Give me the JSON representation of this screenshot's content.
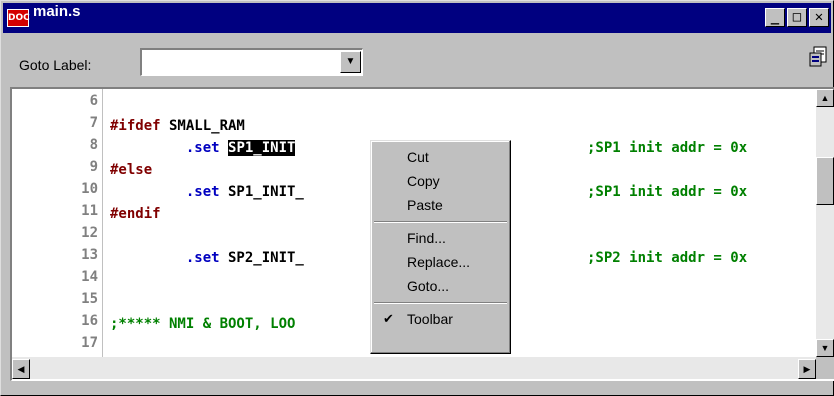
{
  "window": {
    "title": "main.s",
    "app_icon_text": "DOC"
  },
  "titlebar_buttons": {
    "minimize": "_",
    "maximize": "□",
    "close": "✕"
  },
  "toolbar": {
    "goto_label": "Goto Label:",
    "goto_value": "",
    "toolbar_icon": "properties-icon"
  },
  "editor": {
    "lines": [
      {
        "num": "6"
      },
      {
        "num": "7",
        "tokens": [
          {
            "t": "#ifdef",
            "c": "kw-red"
          },
          {
            "t": " SMALL_RAM",
            "c": "txt"
          }
        ]
      },
      {
        "num": "8",
        "tokens": [
          {
            "t": "         .set",
            "c": "kw-blue"
          },
          {
            "t": " ",
            "c": "txt"
          },
          {
            "t": "SP1_INIT",
            "c": "sel"
          }
        ],
        "comment": ";SP1 init addr = 0x"
      },
      {
        "num": "9",
        "tokens": [
          {
            "t": "#else",
            "c": "kw-red"
          }
        ]
      },
      {
        "num": "10",
        "tokens": [
          {
            "t": "         .set",
            "c": "kw-blue"
          },
          {
            "t": " SP1_INIT_",
            "c": "txt"
          }
        ],
        "comment": ";SP1 init addr = 0x"
      },
      {
        "num": "11",
        "tokens": [
          {
            "t": "#endif",
            "c": "kw-red"
          }
        ]
      },
      {
        "num": "12"
      },
      {
        "num": "13",
        "tokens": [
          {
            "t": "         .set",
            "c": "kw-blue"
          },
          {
            "t": " SP2_INIT_",
            "c": "txt"
          }
        ],
        "comment": ";SP2 init addr = 0x"
      },
      {
        "num": "14"
      },
      {
        "num": "15"
      },
      {
        "num": "16",
        "tokens": [
          {
            "t": ";***** NMI & BOOT, LOO",
            "c": "c-green"
          }
        ]
      },
      {
        "num": "17"
      }
    ]
  },
  "context_menu": {
    "items": [
      {
        "label": "Cut",
        "checked": false
      },
      {
        "label": "Copy",
        "checked": false
      },
      {
        "label": "Paste",
        "checked": false
      },
      {
        "separator": true
      },
      {
        "label": "Find...",
        "checked": false
      },
      {
        "label": "Replace...",
        "checked": false
      },
      {
        "label": "Goto...",
        "checked": false
      },
      {
        "separator": true
      },
      {
        "label": "Toolbar",
        "checked": true
      }
    ]
  },
  "colors": {
    "titlebar": "#000080",
    "keyword_red": "#800000",
    "keyword_blue": "#0000c0",
    "comment_green": "#008000"
  }
}
